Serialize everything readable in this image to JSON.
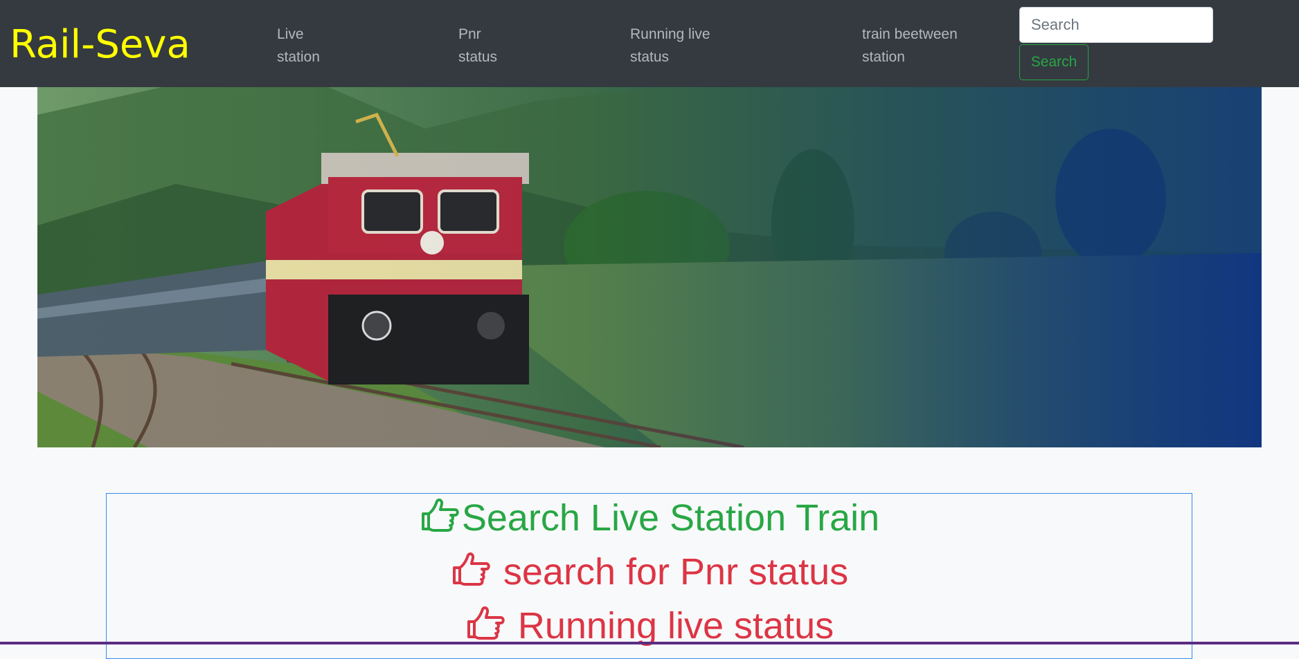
{
  "navbar": {
    "brand": "Rail-Seva",
    "brand_color": "#ffff00",
    "background": "#343a40",
    "links": [
      {
        "line1": "Live",
        "line2": "station"
      },
      {
        "line1": "Pnr",
        "line2": "status"
      },
      {
        "line1": "Running live",
        "line2": "status"
      },
      {
        "line1": "train beetween",
        "line2": "station"
      }
    ],
    "search": {
      "placeholder": "Search",
      "button_label": "Search"
    }
  },
  "hero": {
    "image_description": "train-hero-image"
  },
  "card": {
    "items": [
      {
        "text": "Search Live Station Train",
        "icon": "hand-point-right-icon",
        "color": "#28a745"
      },
      {
        "text": " search for Pnr status",
        "icon": "hand-point-right-icon",
        "color": "#dc3545"
      },
      {
        "text": " Running live status",
        "icon": "hand-point-right-icon",
        "color": "#dc3545"
      }
    ]
  }
}
